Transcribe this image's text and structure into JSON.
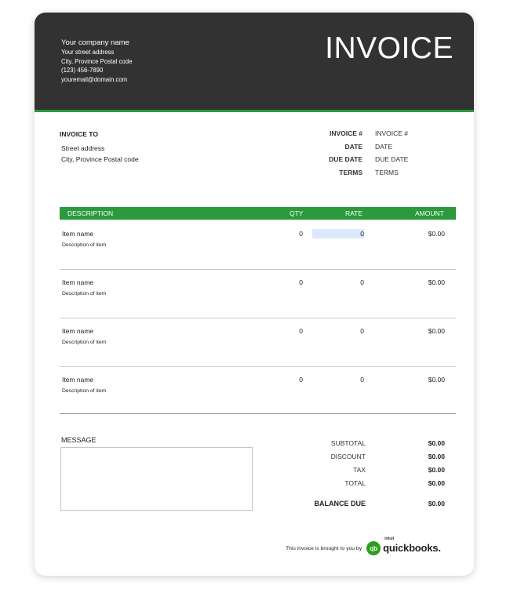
{
  "company": {
    "name": "Your company name",
    "street": "Your street address",
    "city": "City, Province  Postal code",
    "phone": "(123) 456-7890",
    "email": "youremail@domain.com"
  },
  "title": "INVOICE",
  "bill_to": {
    "heading": "INVOICE TO",
    "street": "Street address",
    "city": "City, Province  Postal code"
  },
  "meta": [
    {
      "label": "INVOICE #",
      "value": "INVOICE #"
    },
    {
      "label": "DATE",
      "value": "DATE"
    },
    {
      "label": "DUE DATE",
      "value": "DUE DATE"
    },
    {
      "label": "TERMS",
      "value": "TERMS"
    }
  ],
  "table": {
    "headers": {
      "description": "DESCRIPTION",
      "qty": "QTY",
      "rate": "RATE",
      "amount": "AMOUNT"
    },
    "rows": [
      {
        "name": "Item name",
        "desc": "Description of item",
        "qty": "0",
        "rate": "0",
        "amount": "$0.00"
      },
      {
        "name": "Item name",
        "desc": "Description of item",
        "qty": "0",
        "rate": "0",
        "amount": "$0.00"
      },
      {
        "name": "Item name",
        "desc": "Description of item",
        "qty": "0",
        "rate": "0",
        "amount": "$0.00"
      },
      {
        "name": "Item name",
        "desc": "Description of item",
        "qty": "0",
        "rate": "0",
        "amount": "$0.00"
      }
    ]
  },
  "message": {
    "label": "MESSAGE",
    "value": ""
  },
  "totals": [
    {
      "label": "SUBTOTAL",
      "value": "$0.00"
    },
    {
      "label": "DISCOUNT",
      "value": "$0.00"
    },
    {
      "label": "TAX",
      "value": "$0.00"
    },
    {
      "label": "TOTAL",
      "value": "$0.00"
    }
  ],
  "balance_due": {
    "label": "BALANCE DUE",
    "value": "$0.00"
  },
  "footer": {
    "text": "This invoice is brought to you by",
    "logo_mark": "qb",
    "logo_small": "intuit",
    "logo_word": "quickbooks."
  },
  "colors": {
    "header_bg": "#323232",
    "accent": "#2a9a3c",
    "highlight": "#dce8fb"
  }
}
